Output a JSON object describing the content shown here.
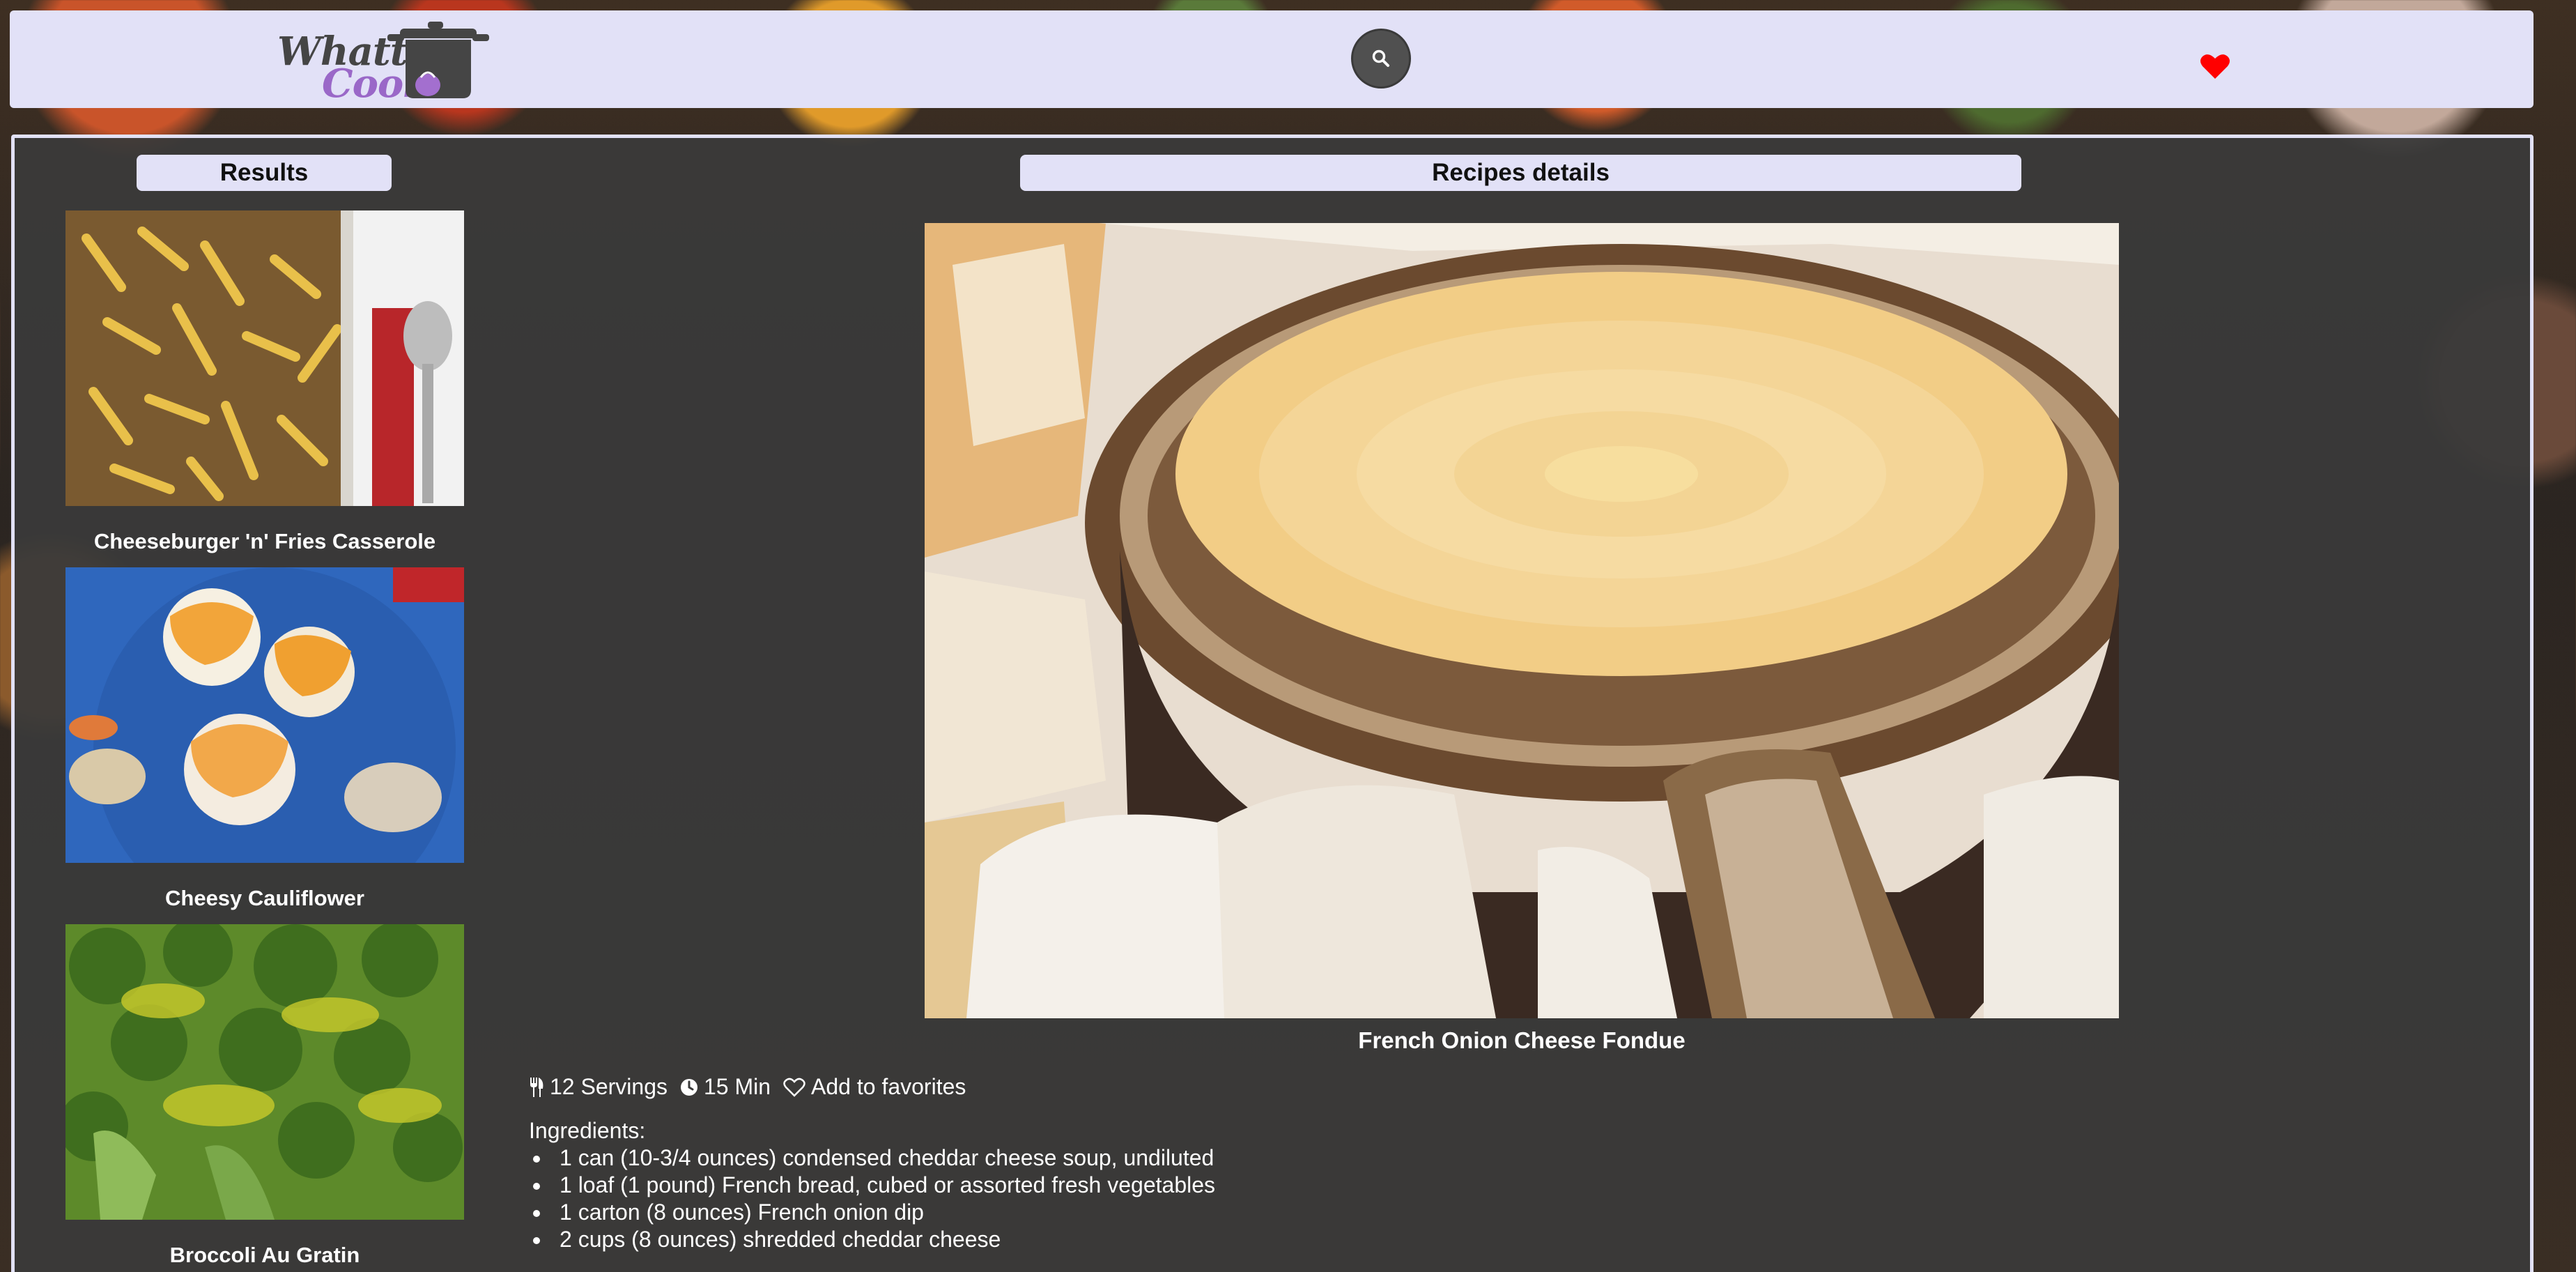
{
  "header": {
    "logo_line1": "Whatta",
    "logo_line2": "Cook",
    "search_icon": "search-icon",
    "favorites_icon": "heart-icon",
    "accent_color": "#e2e1f7",
    "heart_color": "#ff0000"
  },
  "results": {
    "heading": "Results",
    "items": [
      {
        "title": "Cheeseburger 'n' Fries Casserole"
      },
      {
        "title": "Cheesy Cauliflower"
      },
      {
        "title": "Broccoli Au Gratin"
      }
    ]
  },
  "details": {
    "heading": "Recipes details",
    "title": "French Onion Cheese Fondue",
    "servings": "12 Servings",
    "time": "15 Min",
    "add_favorites": "Add to favorites",
    "ingredients_label": "Ingredients:",
    "ingredients": [
      "1 can (10-3/4 ounces) condensed cheddar cheese soup, undiluted",
      "1 loaf (1 pound) French bread, cubed or assorted fresh vegetables",
      "1 carton (8 ounces) French onion dip",
      "2 cups (8 ounces) shredded cheddar cheese"
    ]
  }
}
